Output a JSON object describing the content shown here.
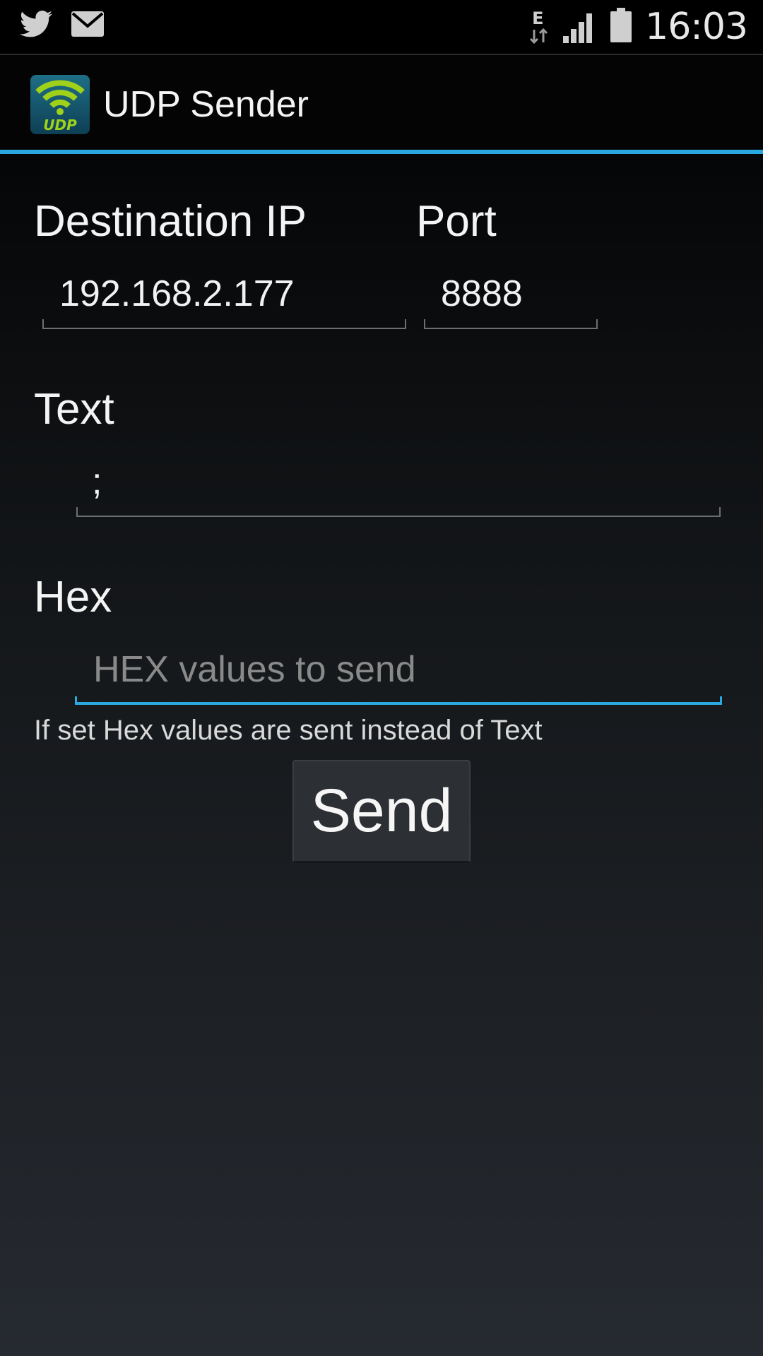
{
  "status_bar": {
    "left_icons": [
      "twitter-icon",
      "mail-icon"
    ],
    "network_type": "E",
    "right_icons": [
      "network-activity-icon",
      "signal-icon",
      "battery-icon"
    ],
    "time": "16:03"
  },
  "action_bar": {
    "logo_icon": "udp-wifi-logo-icon",
    "title": "UDP Sender",
    "accent_color": "#2aa9e0"
  },
  "form": {
    "destination_ip": {
      "label": "Destination IP",
      "value": "192.168.2.177"
    },
    "port": {
      "label": "Port",
      "value": "8888"
    },
    "text": {
      "label": "Text",
      "value": ";"
    },
    "hex": {
      "label": "Hex",
      "value": "",
      "placeholder": "HEX values to send",
      "focused": true
    },
    "hint": "If set Hex values are sent instead of Text",
    "send_label": "Send"
  }
}
